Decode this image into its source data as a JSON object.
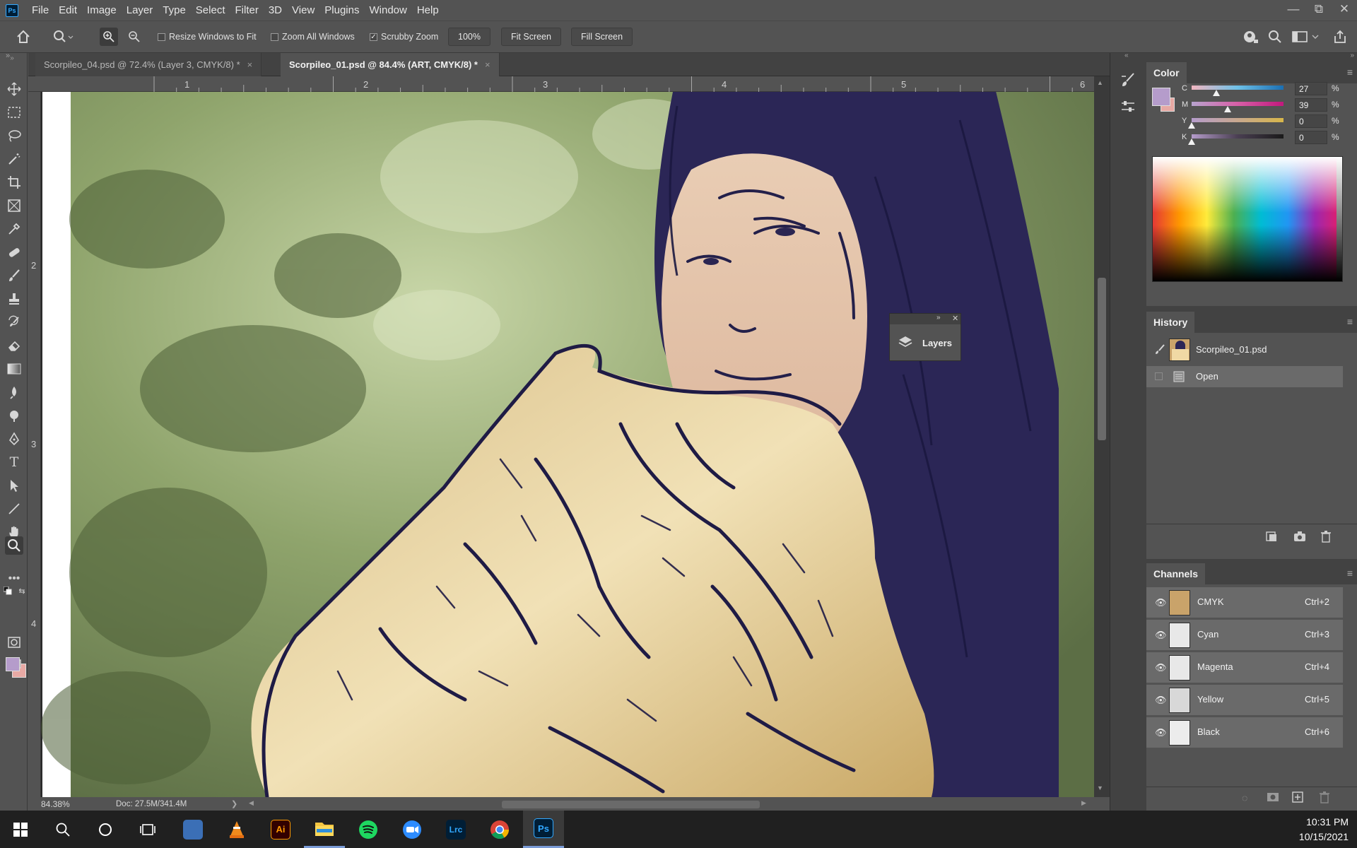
{
  "app": {
    "logo": "Ps"
  },
  "menu": [
    "File",
    "Edit",
    "Image",
    "Layer",
    "Type",
    "Select",
    "Filter",
    "3D",
    "View",
    "Plugins",
    "Window",
    "Help"
  ],
  "window_controls": {
    "minimize": "—",
    "restore": "⧉",
    "close": "✕"
  },
  "options": {
    "resize_windows": {
      "label": "Resize Windows to Fit",
      "checked": false
    },
    "zoom_all": {
      "label": "Zoom All Windows",
      "checked": false
    },
    "scrubby_zoom": {
      "label": "Scrubby Zoom",
      "checked": true
    },
    "zoom_pct": "100%",
    "fit_screen": "Fit Screen",
    "fill_screen": "Fill Screen"
  },
  "tabs": [
    {
      "label": "Scorpileo_04.psd @ 72.4% (Layer 3, CMYK/8) *",
      "close": "×"
    },
    {
      "label": "Scorpileo_01.psd @ 84.4% (ART, CMYK/8) *",
      "close": "×"
    }
  ],
  "ruler_top": [
    "1",
    "2",
    "3",
    "4",
    "5",
    "6"
  ],
  "ruler_left": [
    "2",
    "3",
    "4"
  ],
  "status": {
    "zoom": "84.38%",
    "doc": "Doc: 27.5M/341.4M",
    "arrow": "❯"
  },
  "floating_layers": {
    "label": "Layers"
  },
  "color_panel": {
    "title": "Color",
    "channels": [
      {
        "label": "C",
        "value": "27",
        "unit": "%",
        "level": 0.27
      },
      {
        "label": "M",
        "value": "39",
        "unit": "%",
        "level": 0.39
      },
      {
        "label": "Y",
        "value": "0",
        "unit": "%",
        "level": 0
      },
      {
        "label": "K",
        "value": "0",
        "unit": "%",
        "level": 0
      }
    ],
    "foreground": "#b59ccb",
    "background": "#e8a9a4"
  },
  "history_panel": {
    "title": "History",
    "items": [
      {
        "label": "Scorpileo_01.psd",
        "kind": "snapshot"
      },
      {
        "label": "Open",
        "kind": "state"
      }
    ]
  },
  "channels_panel": {
    "title": "Channels",
    "rows": [
      {
        "name": "CMYK",
        "shortcut": "Ctrl+2"
      },
      {
        "name": "Cyan",
        "shortcut": "Ctrl+3"
      },
      {
        "name": "Magenta",
        "shortcut": "Ctrl+4"
      },
      {
        "name": "Yellow",
        "shortcut": "Ctrl+5"
      },
      {
        "name": "Black",
        "shortcut": "Ctrl+6"
      }
    ]
  },
  "taskbar": {
    "apps": [
      {
        "name": "calculator-icon",
        "text": ""
      },
      {
        "name": "vlc-icon",
        "text": ""
      },
      {
        "name": "illustrator-icon",
        "text": "Ai"
      },
      {
        "name": "file-explorer-icon",
        "text": ""
      },
      {
        "name": "spotify-icon",
        "text": ""
      },
      {
        "name": "zoom-icon",
        "text": ""
      },
      {
        "name": "lightroom-classic-icon",
        "text": "Lrc"
      },
      {
        "name": "chrome-icon",
        "text": ""
      },
      {
        "name": "photoshop-icon",
        "text": "Ps"
      }
    ],
    "time": "10:31 PM",
    "date": "10/15/2021"
  }
}
